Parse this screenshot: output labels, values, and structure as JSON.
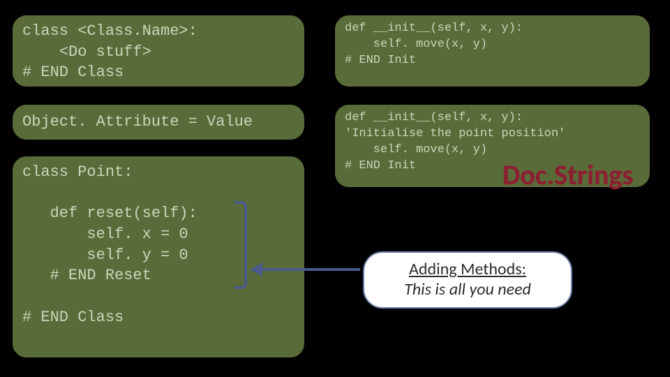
{
  "box_class_template": "class <Class.Name>:\n    <Do stuff>\n# END Class",
  "box_attribute": "Object. Attribute = Value",
  "box_point": "class Point:\n\n   def reset(self):\n       self. x = 0\n       self. y = 0\n   # END Reset\n\n# END Class",
  "box_init": "def __init__(self, x, y):\n    self. move(x, y)\n# END Init",
  "box_init_doc": "def __init__(self, x, y):\n'Initialise the point position'\n    self. move(x, y)\n# END Init",
  "docstrings_label": "Doc.Strings",
  "callout": {
    "line1": "Adding Methods:",
    "line2": "This is all you need"
  }
}
